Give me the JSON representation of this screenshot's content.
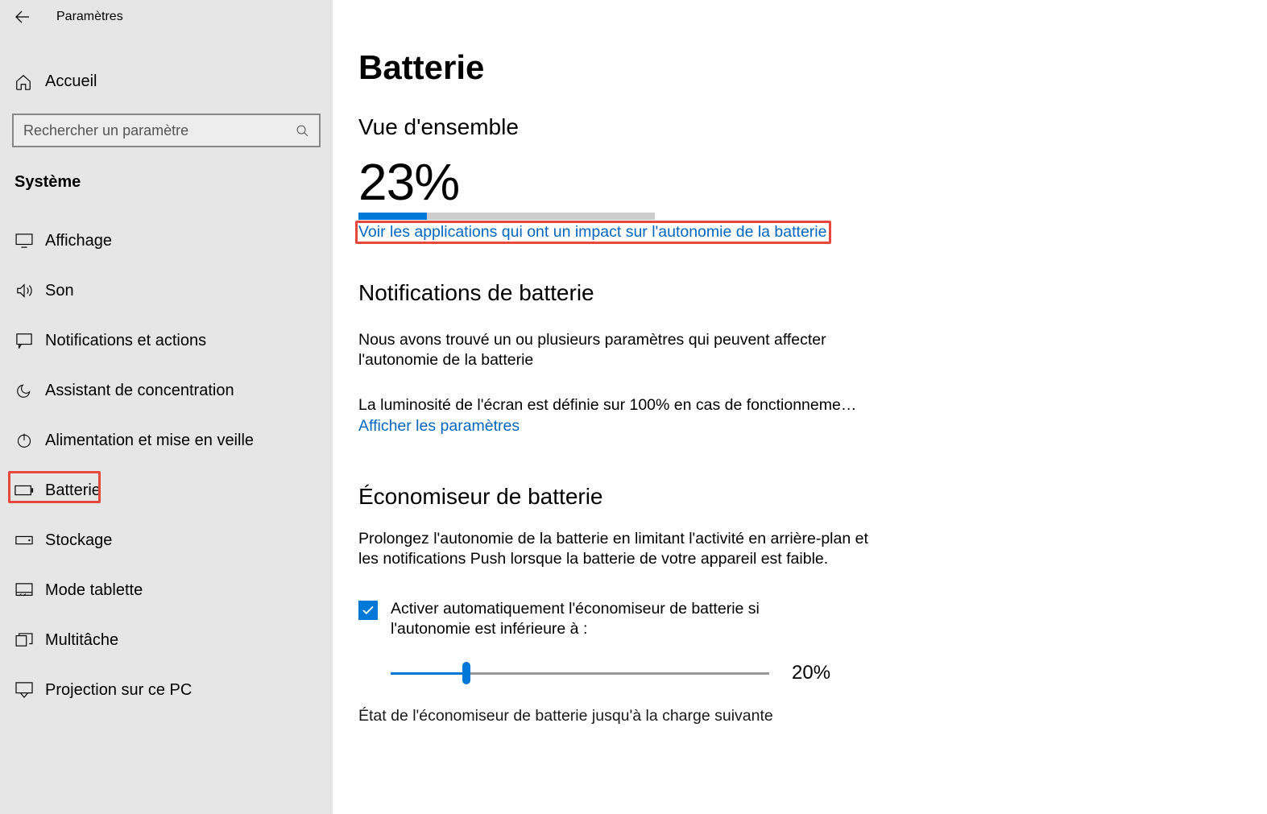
{
  "header": {
    "title": "Paramètres"
  },
  "home": {
    "label": "Accueil"
  },
  "search": {
    "placeholder": "Rechercher un paramètre"
  },
  "category": "Système",
  "nav": {
    "display": "Affichage",
    "sound": "Son",
    "notifications": "Notifications et actions",
    "focus": "Assistant de concentration",
    "power": "Alimentation et mise en veille",
    "battery": "Batterie",
    "storage": "Stockage",
    "tablet": "Mode tablette",
    "multitask": "Multitâche",
    "projection": "Projection sur ce PC"
  },
  "main": {
    "title": "Batterie",
    "overview_heading": "Vue d'ensemble",
    "percent_text": "23%",
    "percent_value": 23,
    "impact_link": "Voir les applications qui ont un impact sur l'autonomie de la batterie",
    "notifications_heading": "Notifications de batterie",
    "notifications_desc": "Nous avons trouvé un ou plusieurs paramètres qui peuvent affecter l'autonomie de la batterie",
    "brightness_text": "La luminosité de l'écran est définie sur 100% en cas de fonctionneme…",
    "brightness_link": "Afficher les paramètres",
    "saver_heading": "Économiseur de batterie",
    "saver_desc": "Prolongez l'autonomie de la batterie en limitant l'activité en arrière-plan et les notifications Push lorsque la batterie de votre appareil est faible.",
    "saver_checkbox_label": "Activer automatiquement l'économiseur de batterie si l'autonomie est inférieure à :",
    "slider_value_text": "20%",
    "slider_value": 20,
    "cut_text": "État de l'économiseur de batterie jusqu'à la charge suivante"
  }
}
